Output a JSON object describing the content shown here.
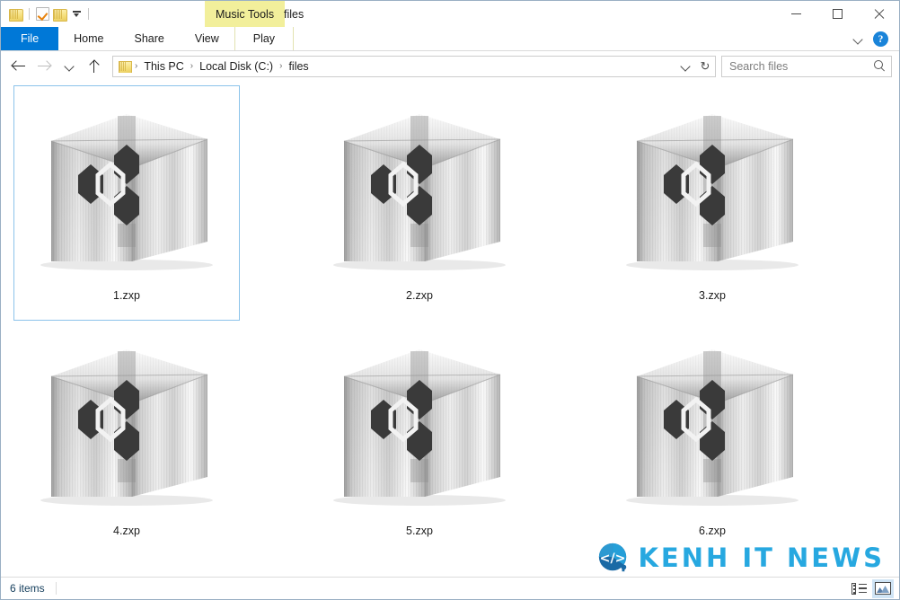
{
  "window": {
    "title": "files",
    "contextual_tab_group": "Music Tools",
    "controls": {
      "minimize": "Minimize",
      "maximize": "Maximize",
      "close": "Close"
    }
  },
  "quick_access": {
    "items": [
      {
        "name": "folder-icon",
        "label": "Folder"
      },
      {
        "name": "properties-icon",
        "label": "Properties"
      },
      {
        "name": "new-folder-icon",
        "label": "New folder"
      },
      {
        "name": "customize-dropdown",
        "label": "Customize Quick Access Toolbar"
      }
    ]
  },
  "ribbon": {
    "tabs": [
      {
        "label": "File",
        "active": true
      },
      {
        "label": "Home",
        "active": false
      },
      {
        "label": "Share",
        "active": false
      },
      {
        "label": "View",
        "active": false
      },
      {
        "label": "Play",
        "active": false,
        "contextual": true
      }
    ],
    "expand_label": "Expand the Ribbon",
    "help_label": "?"
  },
  "address_bar": {
    "back_label": "Back",
    "forward_label": "Forward",
    "recent_label": "Recent locations",
    "up_label": "Up",
    "breadcrumbs": [
      "This PC",
      "Local Disk (C:)",
      "files"
    ],
    "separator": "›",
    "dropdown_label": "Previous locations",
    "refresh_label": "Refresh"
  },
  "search": {
    "placeholder": "Search files",
    "value": "",
    "icon": "search-icon"
  },
  "files": {
    "items": [
      {
        "name": "1.zxp",
        "selected": true
      },
      {
        "name": "2.zxp",
        "selected": false
      },
      {
        "name": "3.zxp",
        "selected": false
      },
      {
        "name": "4.zxp",
        "selected": false
      },
      {
        "name": "5.zxp",
        "selected": false
      },
      {
        "name": "6.zxp",
        "selected": false
      }
    ]
  },
  "status_bar": {
    "item_count": "6 items",
    "views": [
      {
        "name": "details-view-button",
        "label": "Details",
        "active": false
      },
      {
        "name": "large-icons-view-button",
        "label": "Large icons",
        "active": true
      }
    ]
  },
  "watermark": {
    "text": "KENH IT NEWS",
    "badge_glyph": "</>",
    "color": "#27a8e0"
  }
}
